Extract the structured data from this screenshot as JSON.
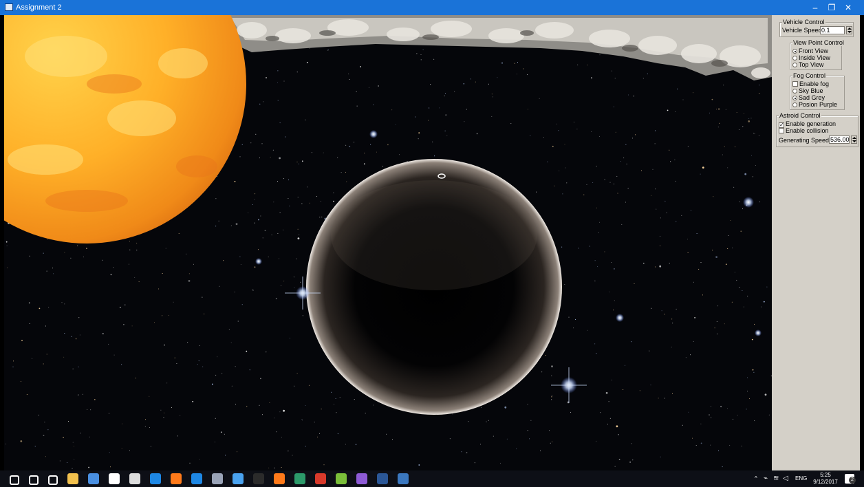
{
  "window": {
    "title": "Assignment 2",
    "minimize_icon": "–",
    "maximize_icon": "❐",
    "close_icon": "✕"
  },
  "panel": {
    "vehicle": {
      "label": "Vehicle Control",
      "speed_label": "Vehicle Speed",
      "speed_value": "0.1"
    },
    "viewpoint": {
      "label": "View Point Control",
      "options": [
        "Front View",
        "Inside View",
        "Top View"
      ],
      "selected": "Front View"
    },
    "fog": {
      "label": "Fog Control",
      "enable_label": "Enable fog",
      "enabled": false,
      "options": [
        "Sky Blue",
        "Sad Grey",
        "Posion Purple"
      ],
      "selected": "Sad Grey"
    },
    "asteroid": {
      "label": "Astroid Control",
      "generation_label": "Enable generation",
      "generation": true,
      "collision_label": "Enable collision",
      "collision": false,
      "speed_label": "Generating Speed",
      "speed_value": "536.00"
    }
  },
  "taskbar": {
    "icons": [
      "windows-start-icon",
      "search-icon",
      "task-view-icon",
      "file-explorer-icon",
      "app-icon",
      "mail-icon",
      "3d-icon",
      "teamviewer-icon",
      "firefox-icon",
      "skype-icon",
      "tool-icon",
      "app-icon-2",
      "terminal-icon",
      "firefox-icon-2",
      "app-icon-3",
      "pdf-icon",
      "notepad-icon",
      "visual-studio-icon",
      "word-icon",
      "opengl-app-icon"
    ],
    "tray": {
      "chevron": "^",
      "language": "ENG",
      "time": "5:25",
      "date": "9/12/2017",
      "notification_count": "2"
    }
  },
  "colors": {
    "titlebar": "#1a73d8",
    "panel": "#d4d0c8",
    "taskbar": "#0d0f16"
  }
}
